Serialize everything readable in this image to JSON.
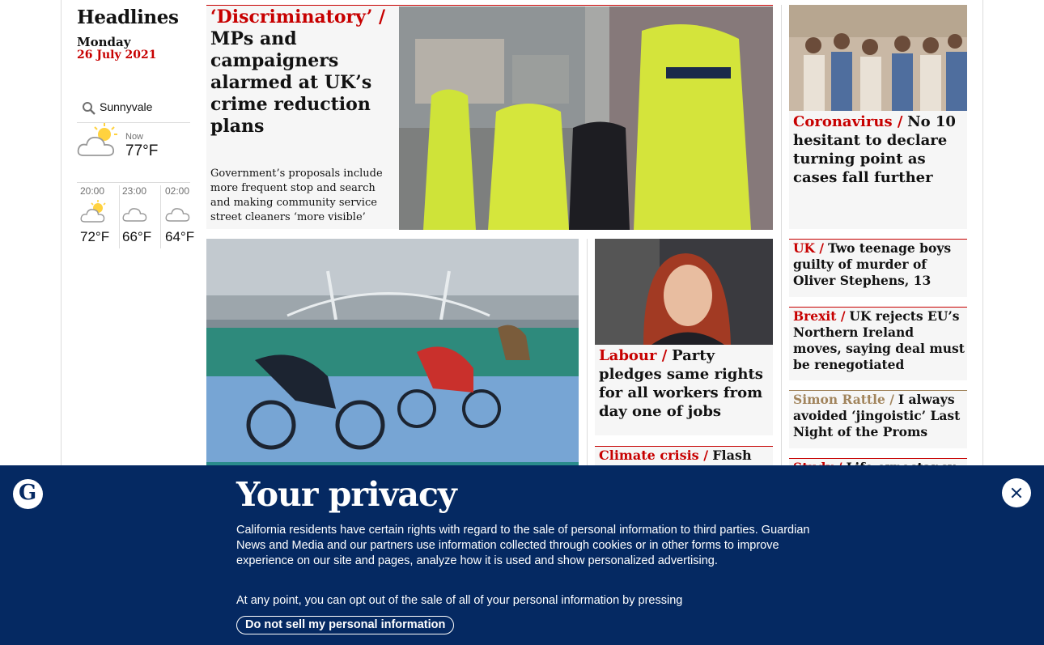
{
  "sidebar": {
    "title": "Headlines",
    "day": "Monday",
    "date": "26 July 2021",
    "weather": {
      "location": "Sunnyvale",
      "now_label": "Now",
      "now_temp": "77°F",
      "now_icon": "partly-cloudy-icon",
      "forecast": [
        {
          "time": "20:00",
          "temp": "72°F",
          "icon": "partly-cloudy-icon"
        },
        {
          "time": "23:00",
          "temp": "66°F",
          "icon": "cloud-icon"
        },
        {
          "time": "02:00",
          "temp": "64°F",
          "icon": "cloud-icon"
        }
      ]
    }
  },
  "lead": {
    "kicker": "‘Discriminatory’ /",
    "headline": "MPs and campaigners alarmed at UK’s crime reduction plans",
    "trail": "Government’s proposals include more frequent stop and search and making community service street cleaners ‘more visible’"
  },
  "stories": {
    "coronavirus": {
      "kicker": "Coronavirus /",
      "headline": "No 10 hesitant to declare turning point as cases fall further"
    },
    "labour": {
      "kicker": "Labour /",
      "headline": "Party pledges same rights for all workers from day one of jobs"
    },
    "climate": {
      "kicker": "Climate crisis /",
      "headline": "Flash"
    },
    "uk": {
      "kicker": "UK /",
      "headline": "Two teenage boys guilty of murder of Oliver Stephens, 13"
    },
    "brexit": {
      "kicker": "Brexit /",
      "headline": "UK rejects EU’s Northern Ireland moves, saying deal must be renegotiated"
    },
    "rattle": {
      "kicker": "Simon Rattle /",
      "headline": "I always avoided ‘jingoistic’ Last Night of the Proms"
    },
    "study": {
      "kicker": "Study /",
      "headline": "Life expectancy"
    }
  },
  "privacy": {
    "title": "Your privacy",
    "body": "California residents have certain rights with regard to the sale of personal information to third parties. Guardian News and Media and our partners use information collected through cookies or in other forms to improve experience on our site and pages, analyze how it is used and show personalized advertising.",
    "body2": "At any point, you can opt out of the sale of all of your personal information by pressing",
    "button": "Do not sell my personal information",
    "logo_letter": "G"
  },
  "colors": {
    "news_red": "#c70000",
    "culture_brown": "#a1845c",
    "banner_blue": "#052962"
  }
}
